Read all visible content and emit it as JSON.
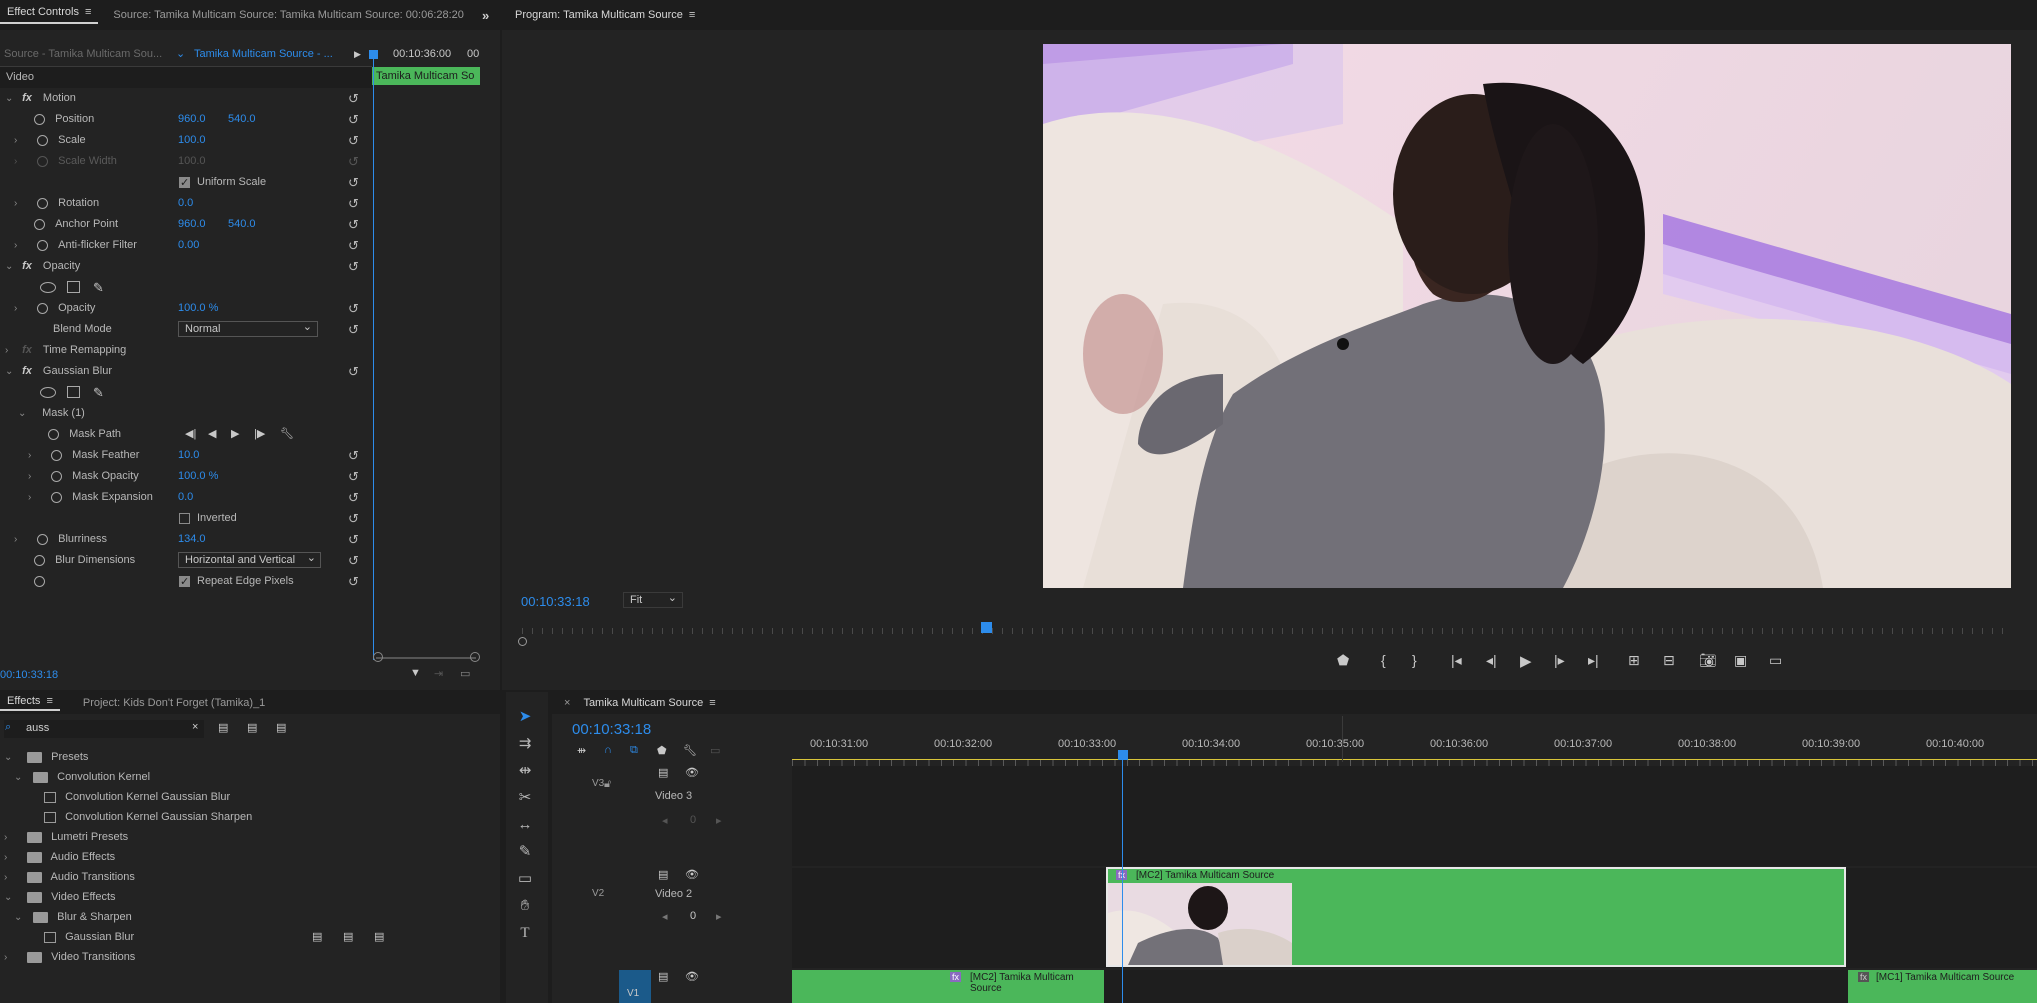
{
  "effect_controls": {
    "tab_label": "Effect Controls",
    "source_tab": "Source: Tamika Multicam Source: Tamika Multicam Source: 00:06:28:20",
    "source_dropdown": "Source - Tamika Multicam Sou...",
    "clip_dropdown": "Tamika Multicam Source - ...",
    "timecode_mini": "00:10:36:00",
    "timecode_mini_b": "00",
    "clip_bar_label": "Tamika Multicam So",
    "section_video": "Video",
    "motion": "Motion",
    "position_label": "Position",
    "position_x": "960.0",
    "position_y": "540.0",
    "scale_label": "Scale",
    "scale_value": "100.0",
    "scale_width_label": "Scale Width",
    "scale_width_value": "100.0",
    "uniform_scale": "Uniform Scale",
    "rotation_label": "Rotation",
    "rotation_value": "0.0",
    "anchor_label": "Anchor Point",
    "anchor_x": "960.0",
    "anchor_y": "540.0",
    "antiflicker_label": "Anti-flicker Filter",
    "antiflicker_value": "0.00",
    "opacity_section": "Opacity",
    "opacity_label": "Opacity",
    "opacity_value": "100.0 %",
    "blend_label": "Blend Mode",
    "blend_value": "Normal",
    "time_remap": "Time Remapping",
    "gaussian_blur": "Gaussian Blur",
    "mask_label": "Mask (1)",
    "mask_path": "Mask Path",
    "mask_feather_label": "Mask Feather",
    "mask_feather_value": "10.0",
    "mask_opacity_label": "Mask Opacity",
    "mask_opacity_value": "100.0 %",
    "mask_expansion_label": "Mask Expansion",
    "mask_expansion_value": "0.0",
    "inverted": "Inverted",
    "blurriness_label": "Blurriness",
    "blurriness_value": "134.0",
    "blur_dim_label": "Blur Dimensions",
    "blur_dim_value": "Horizontal and Vertical",
    "repeat_edge": "Repeat Edge Pixels",
    "bottom_timecode": "00:10:33:18"
  },
  "program": {
    "tab_label": "Program: Tamika Multicam Source",
    "timecode": "00:10:33:18",
    "fit": "Fit"
  },
  "effects": {
    "tab_label": "Effects",
    "project_tab": "Project: Kids Don't Forget (Tamika)_1",
    "search_value": "auss",
    "items": [
      {
        "label": "Presets"
      },
      {
        "label": "Convolution Kernel"
      },
      {
        "label": "Convolution Kernel Gaussian Blur"
      },
      {
        "label": "Convolution Kernel Gaussian Sharpen"
      },
      {
        "label": "Lumetri Presets"
      },
      {
        "label": "Audio Effects"
      },
      {
        "label": "Audio Transitions"
      },
      {
        "label": "Video Effects"
      },
      {
        "label": "Blur & Sharpen"
      },
      {
        "label": "Gaussian Blur"
      },
      {
        "label": "Video Transitions"
      }
    ]
  },
  "timeline": {
    "tab_label": "Tamika Multicam Source",
    "timecode": "00:10:33:18",
    "ruler": [
      "00:10:31:00",
      "00:10:32:00",
      "00:10:33:00",
      "00:10:34:00",
      "00:10:35:00",
      "00:10:36:00",
      "00:10:37:00",
      "00:10:38:00",
      "00:10:39:00",
      "00:10:40:00"
    ],
    "v3_id": "V3",
    "v3_name": "Video 3",
    "v2_id": "V2",
    "v2_name": "Video 2",
    "v1_id": "V1",
    "v2_keyframe_value": "0",
    "v3_keyframe_value": "0",
    "clip_v2": "[MC2] Tamika Multicam Source",
    "clip_v1_left": "[MC2] Tamika Multicam Source",
    "clip_v1_right": "[MC1] Tamika Multicam Source",
    "fx_badge": "fx"
  },
  "colors": {
    "accent": "#2d8ceb",
    "clip_green": "#4bb75a",
    "panel": "#232323"
  }
}
